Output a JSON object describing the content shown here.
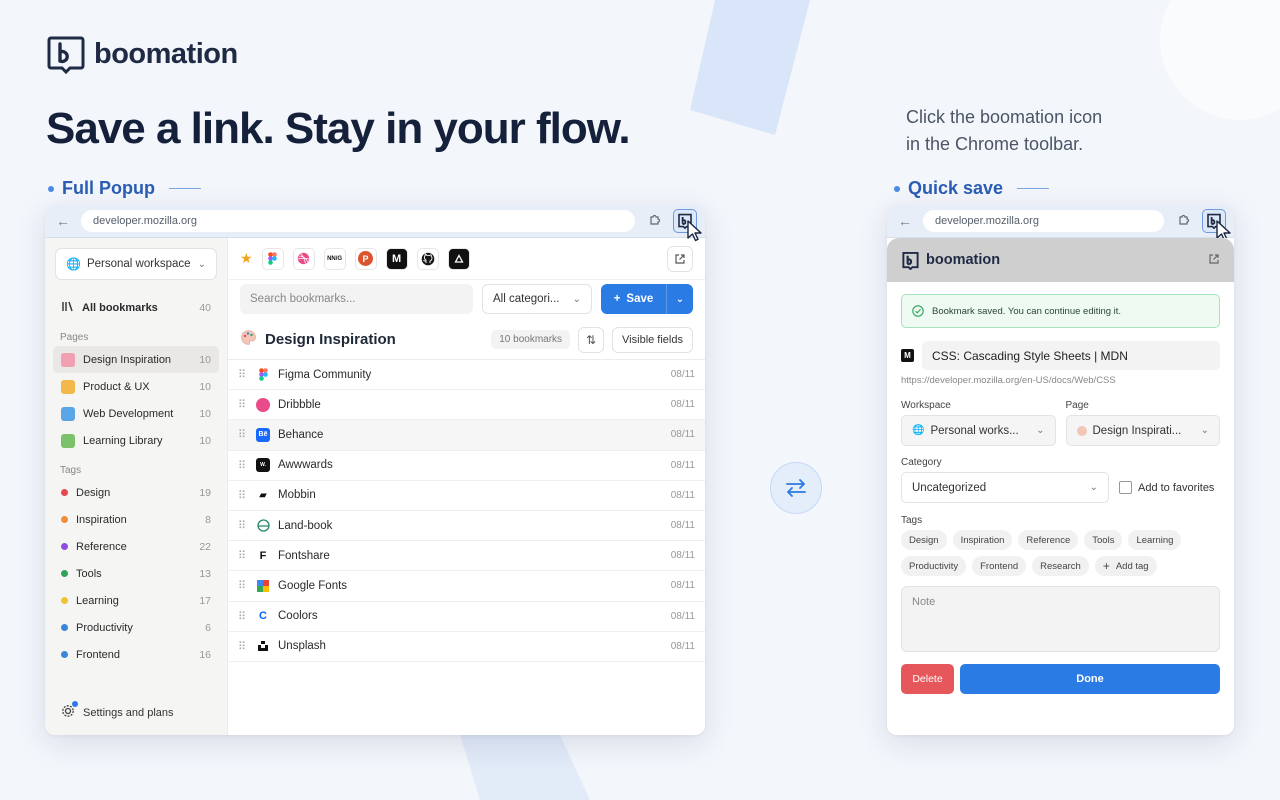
{
  "brand": {
    "name": "boomation"
  },
  "hero": {
    "title": "Save a link. Stay in your flow."
  },
  "caption": {
    "line1": "Click the boomation icon",
    "line2": "in the Chrome toolbar."
  },
  "sections": {
    "full_popup": "Full Popup",
    "quick_save": "Quick save"
  },
  "browser": {
    "url": "developer.mozilla.org"
  },
  "popup": {
    "workspace": "Personal workspace",
    "all_bookmarks": {
      "label": "All bookmarks",
      "count": "40"
    },
    "pages_label": "Pages",
    "pages": [
      {
        "label": "Design Inspiration",
        "count": "10",
        "color": "#f0a0b0"
      },
      {
        "label": "Product & UX",
        "count": "10",
        "color": "#f2b84b"
      },
      {
        "label": "Web Development",
        "count": "10",
        "color": "#5aa5e6"
      },
      {
        "label": "Learning Library",
        "count": "10",
        "color": "#7bc26a"
      }
    ],
    "tags_label": "Tags",
    "tags": [
      {
        "label": "Design",
        "count": "19",
        "color": "#e5484d"
      },
      {
        "label": "Inspiration",
        "count": "8",
        "color": "#f28c38"
      },
      {
        "label": "Reference",
        "count": "22",
        "color": "#8e4ee0"
      },
      {
        "label": "Tools",
        "count": "13",
        "color": "#2fa35a"
      },
      {
        "label": "Learning",
        "count": "17",
        "color": "#f2c230"
      },
      {
        "label": "Productivity",
        "count": "6",
        "color": "#3a86d9"
      },
      {
        "label": "Frontend",
        "count": "16",
        "color": "#3a86d9"
      }
    ],
    "settings": "Settings and plans",
    "search_placeholder": "Search bookmarks...",
    "category": "All categori...",
    "save_label": "Save",
    "page_title": "Design Inspiration",
    "bookmark_count": "10 bookmarks",
    "visible_fields": "Visible fields",
    "favicons": [
      "star",
      "figma",
      "dribbble",
      "nn/g",
      "producthunt",
      "mobbin",
      "github",
      "vercel"
    ],
    "bookmarks": [
      {
        "name": "Figma Community",
        "date": "08/11"
      },
      {
        "name": "Dribbble",
        "date": "08/11"
      },
      {
        "name": "Behance",
        "date": "08/11"
      },
      {
        "name": "Awwwards",
        "date": "08/11"
      },
      {
        "name": "Mobbin",
        "date": "08/11"
      },
      {
        "name": "Land-book",
        "date": "08/11"
      },
      {
        "name": "Fontshare",
        "date": "08/11"
      },
      {
        "name": "Google Fonts",
        "date": "08/11"
      },
      {
        "name": "Coolors",
        "date": "08/11"
      },
      {
        "name": "Unsplash",
        "date": "08/11"
      }
    ]
  },
  "quicksave": {
    "alert": "Bookmark saved. You can continue editing it.",
    "title_value": "CSS: Cascading Style Sheets | MDN",
    "url": "https://developer.mozilla.org/en-US/docs/Web/CSS",
    "workspace_label": "Workspace",
    "workspace_value": "Personal works...",
    "page_label": "Page",
    "page_value": "Design Inspirati...",
    "category_label": "Category",
    "category_value": "Uncategorized",
    "favorites_label": "Add to favorites",
    "tags_label": "Tags",
    "tags": [
      "Design",
      "Inspiration",
      "Reference",
      "Tools",
      "Learning",
      "Productivity",
      "Frontend",
      "Research"
    ],
    "add_tag": "Add tag",
    "note_placeholder": "Note",
    "delete_label": "Delete",
    "done_label": "Done"
  },
  "colors": {
    "accent": "#2b7be4",
    "danger": "#e5575b",
    "heading": "#15203b",
    "section": "#2a5db3"
  }
}
